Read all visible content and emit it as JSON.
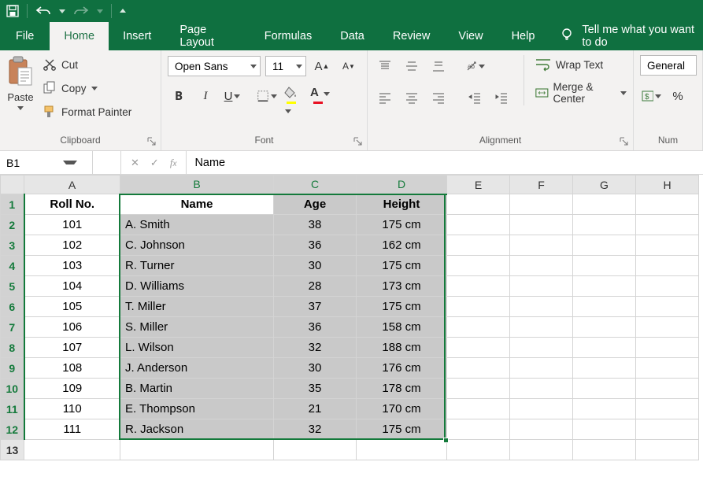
{
  "qat": {
    "save": "save",
    "undo": "undo",
    "redo": "redo"
  },
  "tabs": {
    "file": "File",
    "items": [
      "Home",
      "Insert",
      "Page Layout",
      "Formulas",
      "Data",
      "Review",
      "View",
      "Help"
    ],
    "active": 0,
    "tell": "Tell me what you want to do"
  },
  "ribbon": {
    "clipboard": {
      "paste": "Paste",
      "cut": "Cut",
      "copy": "Copy",
      "format_painter": "Format Painter",
      "label": "Clipboard"
    },
    "font": {
      "name": "Open Sans",
      "size": "11",
      "label": "Font"
    },
    "alignment": {
      "wrap": "Wrap Text",
      "merge": "Merge & Center",
      "label": "Alignment"
    },
    "number": {
      "format": "General",
      "label": "Num"
    }
  },
  "namebox": "B1",
  "formula": "Name",
  "columns": [
    "A",
    "B",
    "C",
    "D",
    "E",
    "F",
    "G",
    "H"
  ],
  "headers": {
    "A": "Roll No.",
    "B": "Name",
    "C": "Age",
    "D": "Height"
  },
  "rows": [
    {
      "r": "101",
      "n": "A. Smith",
      "a": "38",
      "h": "175 cm"
    },
    {
      "r": "102",
      "n": "C. Johnson",
      "a": "36",
      "h": "162 cm"
    },
    {
      "r": "103",
      "n": "R. Turner",
      "a": "30",
      "h": "175 cm"
    },
    {
      "r": "104",
      "n": "D. Williams",
      "a": "28",
      "h": "173 cm"
    },
    {
      "r": "105",
      "n": "T. Miller",
      "a": "37",
      "h": "175 cm"
    },
    {
      "r": "106",
      "n": "S. Miller",
      "a": "36",
      "h": "158 cm"
    },
    {
      "r": "107",
      "n": "L. Wilson",
      "a": "32",
      "h": "188 cm"
    },
    {
      "r": "108",
      "n": "J. Anderson",
      "a": "30",
      "h": "176 cm"
    },
    {
      "r": "109",
      "n": "B. Martin",
      "a": "35",
      "h": "178 cm"
    },
    {
      "r": "110",
      "n": "E. Thompson",
      "a": "21",
      "h": "170 cm"
    },
    {
      "r": "111",
      "n": "R. Jackson",
      "a": "32",
      "h": "175 cm"
    }
  ],
  "chart_data": {
    "type": "table",
    "title": "",
    "columns": [
      "Roll No.",
      "Name",
      "Age",
      "Height"
    ],
    "data": [
      [
        101,
        "A. Smith",
        38,
        "175 cm"
      ],
      [
        102,
        "C. Johnson",
        36,
        "162 cm"
      ],
      [
        103,
        "R. Turner",
        30,
        "175 cm"
      ],
      [
        104,
        "D. Williams",
        28,
        "173 cm"
      ],
      [
        105,
        "T. Miller",
        37,
        "175 cm"
      ],
      [
        106,
        "S. Miller",
        36,
        "158 cm"
      ],
      [
        107,
        "L. Wilson",
        32,
        "188 cm"
      ],
      [
        108,
        "J. Anderson",
        30,
        "176 cm"
      ],
      [
        109,
        "B. Martin",
        35,
        "178 cm"
      ],
      [
        110,
        "E. Thompson",
        21,
        "170 cm"
      ],
      [
        111,
        "R. Jackson",
        32,
        "175 cm"
      ]
    ]
  }
}
